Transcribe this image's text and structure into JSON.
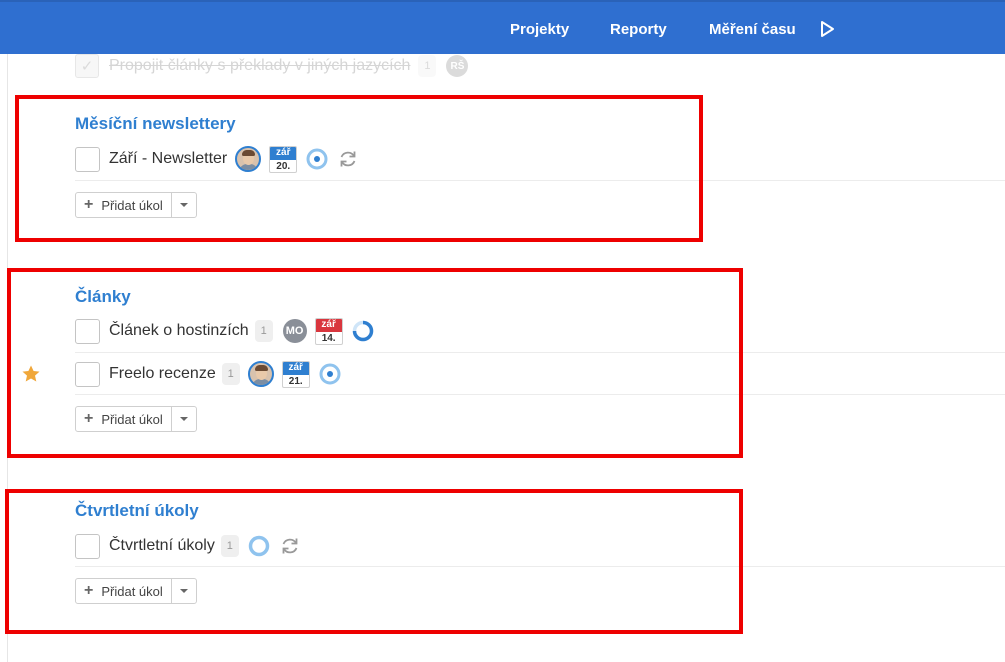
{
  "nav": {
    "items": [
      {
        "label": "Projekty"
      },
      {
        "label": "Reporty"
      },
      {
        "label": "Měření času"
      }
    ],
    "play_icon": "play-icon",
    "bg_color": "#2f6fd0"
  },
  "faded_task": {
    "name": "Propojit články s překlady v jiných jazycích",
    "count": "1",
    "initials": "RŠ"
  },
  "sections": [
    {
      "title": "Měsíční newslettery",
      "tasks": [
        {
          "name": "Září - Newsletter",
          "count": null,
          "assignee": "avatar",
          "date_month": "zář",
          "date_day": "20.",
          "date_color": "#2f7fd0",
          "status": "in-progress-ring",
          "recurring": true
        }
      ],
      "add_label": "Přidat úkol"
    },
    {
      "title": "Články",
      "tasks": [
        {
          "name": "Článek o hostinzích",
          "count": "1",
          "assignee_initials": "MO",
          "date_month": "zář",
          "date_day": "14.",
          "date_color": "#d9363e",
          "status": "progress-ring"
        },
        {
          "name": "Freelo recenze",
          "count": "1",
          "assignee": "avatar",
          "date_month": "zář",
          "date_day": "21.",
          "date_color": "#2f7fd0",
          "status": "in-progress-ring",
          "starred": true
        }
      ],
      "add_label": "Přidat úkol"
    },
    {
      "title": "Čtvrtletní úkoly",
      "tasks": [
        {
          "name": "Čtvrtletní úkoly",
          "count": "1",
          "status": "open-ring",
          "recurring": true
        }
      ],
      "add_label": "Přidat úkol"
    }
  ],
  "colors": {
    "accent": "#2f7fd0",
    "highlight": "#ee0000",
    "star": "#f0a73a"
  }
}
